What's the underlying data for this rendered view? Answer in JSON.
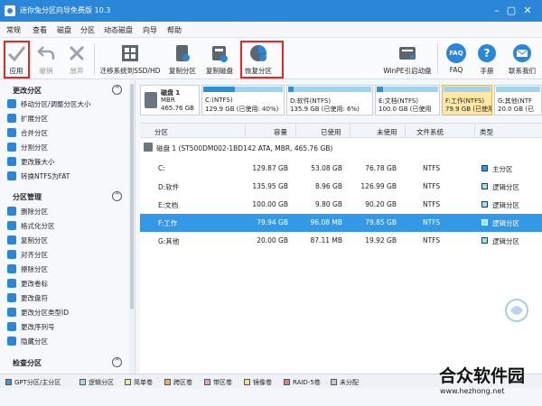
{
  "window": {
    "title": "迷你兔分区向导免费版 10.3"
  },
  "menu": [
    "常规",
    "查看",
    "磁盘",
    "分区",
    "动态磁盘",
    "向导",
    "帮助"
  ],
  "toolbar": {
    "apply": "应用",
    "undo": "撤销",
    "discard": "放弃",
    "migrate": "迁移系统到SSD/HD",
    "copy_disk": "复制分区",
    "copy_part": "复制磁盘",
    "recover": "恢复分区",
    "winpe": "WinPE引启动盘",
    "faq": "FAQ",
    "manual": "手册",
    "contact": "联系我们",
    "faq_icon_text": "FAQ"
  },
  "left_panel": {
    "sections": [
      {
        "title": "更改分区",
        "items": [
          "移动分区/调整分区大小",
          "扩展分区",
          "合并分区",
          "分割分区",
          "更改簇大小",
          "转换NTFS为FAT"
        ]
      },
      {
        "title": "分区管理",
        "items": [
          "删除分区",
          "格式化分区",
          "复制分区",
          "对齐分区",
          "擦除分区",
          "更改卷标",
          "更改盘符",
          "更改分区类型ID",
          "更改序列号",
          "隐藏分区"
        ]
      },
      {
        "title": "检查分区",
        "items": []
      }
    ],
    "collapse_symbol": "^"
  },
  "disk_map": {
    "disk": {
      "name": "磁盘 1",
      "type": "MBR",
      "size": "465.76 GB"
    },
    "partitions": [
      {
        "name": "C:(NTFS)",
        "info": "129.9 GB (已使用: 40%)",
        "used": 0.4
      },
      {
        "name": "D:软件(NTFS)",
        "info": "135.9 GB (已使用: 6%)",
        "used": 0.06
      },
      {
        "name": "E:文档(NTFS)",
        "info": "100.0 GB (已使用",
        "used": 0.1
      },
      {
        "name": "F:工作(NTFS)",
        "info": "79.9 GB (已使用",
        "used": 0.0
      },
      {
        "name": "G:其他(NTF",
        "info": "20.0 GB (已",
        "used": 0.0
      }
    ]
  },
  "table": {
    "headers": [
      "分区",
      "容量",
      "已使用",
      "未使用",
      "文件系统",
      "类型"
    ],
    "disk_row": "磁盘 1 (ST500DM002-1BD142 ATA, MBR, 465.76 GB)",
    "rows": [
      {
        "part": "C:",
        "cap": "129.87 GB",
        "used": "53.08 GB",
        "free": "76.78 GB",
        "fs": "NTFS",
        "type": "主分区"
      },
      {
        "part": "D:软件",
        "cap": "135.95 GB",
        "used": "8.96 GB",
        "free": "126.99 GB",
        "fs": "NTFS",
        "type": "逻辑分区"
      },
      {
        "part": "E:文档",
        "cap": "100.00 GB",
        "used": "9.80 GB",
        "free": "90.20 GB",
        "fs": "NTFS",
        "type": "逻辑分区"
      },
      {
        "part": "F:工作",
        "cap": "79.94 GB",
        "used": "96.08 MB",
        "free": "79.85 GB",
        "fs": "NTFS",
        "type": "逻辑分区"
      },
      {
        "part": "G:其他",
        "cap": "20.00 GB",
        "used": "87.11 MB",
        "free": "19.92 GB",
        "fs": "NTFS",
        "type": "逻辑分区"
      }
    ]
  },
  "legend": [
    "GPT分区/主分区",
    "逻辑分区",
    "简单卷",
    "跨区卷",
    "带区卷",
    "镜像卷",
    "RAID-5卷",
    "未分配"
  ],
  "watermark": {
    "brand": "合众软件园",
    "url": "www.hezhong.net"
  },
  "colors": {
    "accent": "#2a86d9",
    "selected_row": "#3399e6",
    "red_highlight": "#ee2222"
  }
}
